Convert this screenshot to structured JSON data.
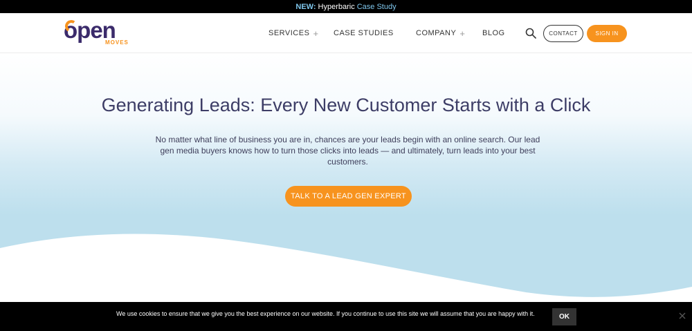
{
  "announcement": {
    "new_label": "NEW:",
    "mid_text": "Hyperbaric",
    "link_text": "Case Study"
  },
  "logo": {
    "word": "open",
    "sub": "MOVES"
  },
  "nav": {
    "services": "SERVICES",
    "case_studies": "CASE STUDIES",
    "company": "COMPANY",
    "blog": "BLOG",
    "plus": "+"
  },
  "header_buttons": {
    "contact": "CONTACT",
    "sign_in": "SIGN IN"
  },
  "hero": {
    "title": "Generating Leads: Every New Customer Starts with a Click",
    "subtitle": "No matter what line of business you are in, chances are your leads begin with an online search. Our lead gen media buyers knows how to turn those clicks into leads — and ultimately, turn leads into your best customers.",
    "cta": "TALK TO A LEAD GEN EXPERT"
  },
  "cookie": {
    "message": "We use cookies to ensure that we give you the best experience on our website. If you continue to use this site we will assume that you are happy with it.",
    "ok": "OK"
  },
  "colors": {
    "accent": "#f7931e",
    "brand": "#3b2b6b",
    "hero_blue": "#bddfed",
    "link_blue": "#7fc6ec"
  },
  "icons": {
    "search": "search-icon",
    "close": "close-icon"
  }
}
